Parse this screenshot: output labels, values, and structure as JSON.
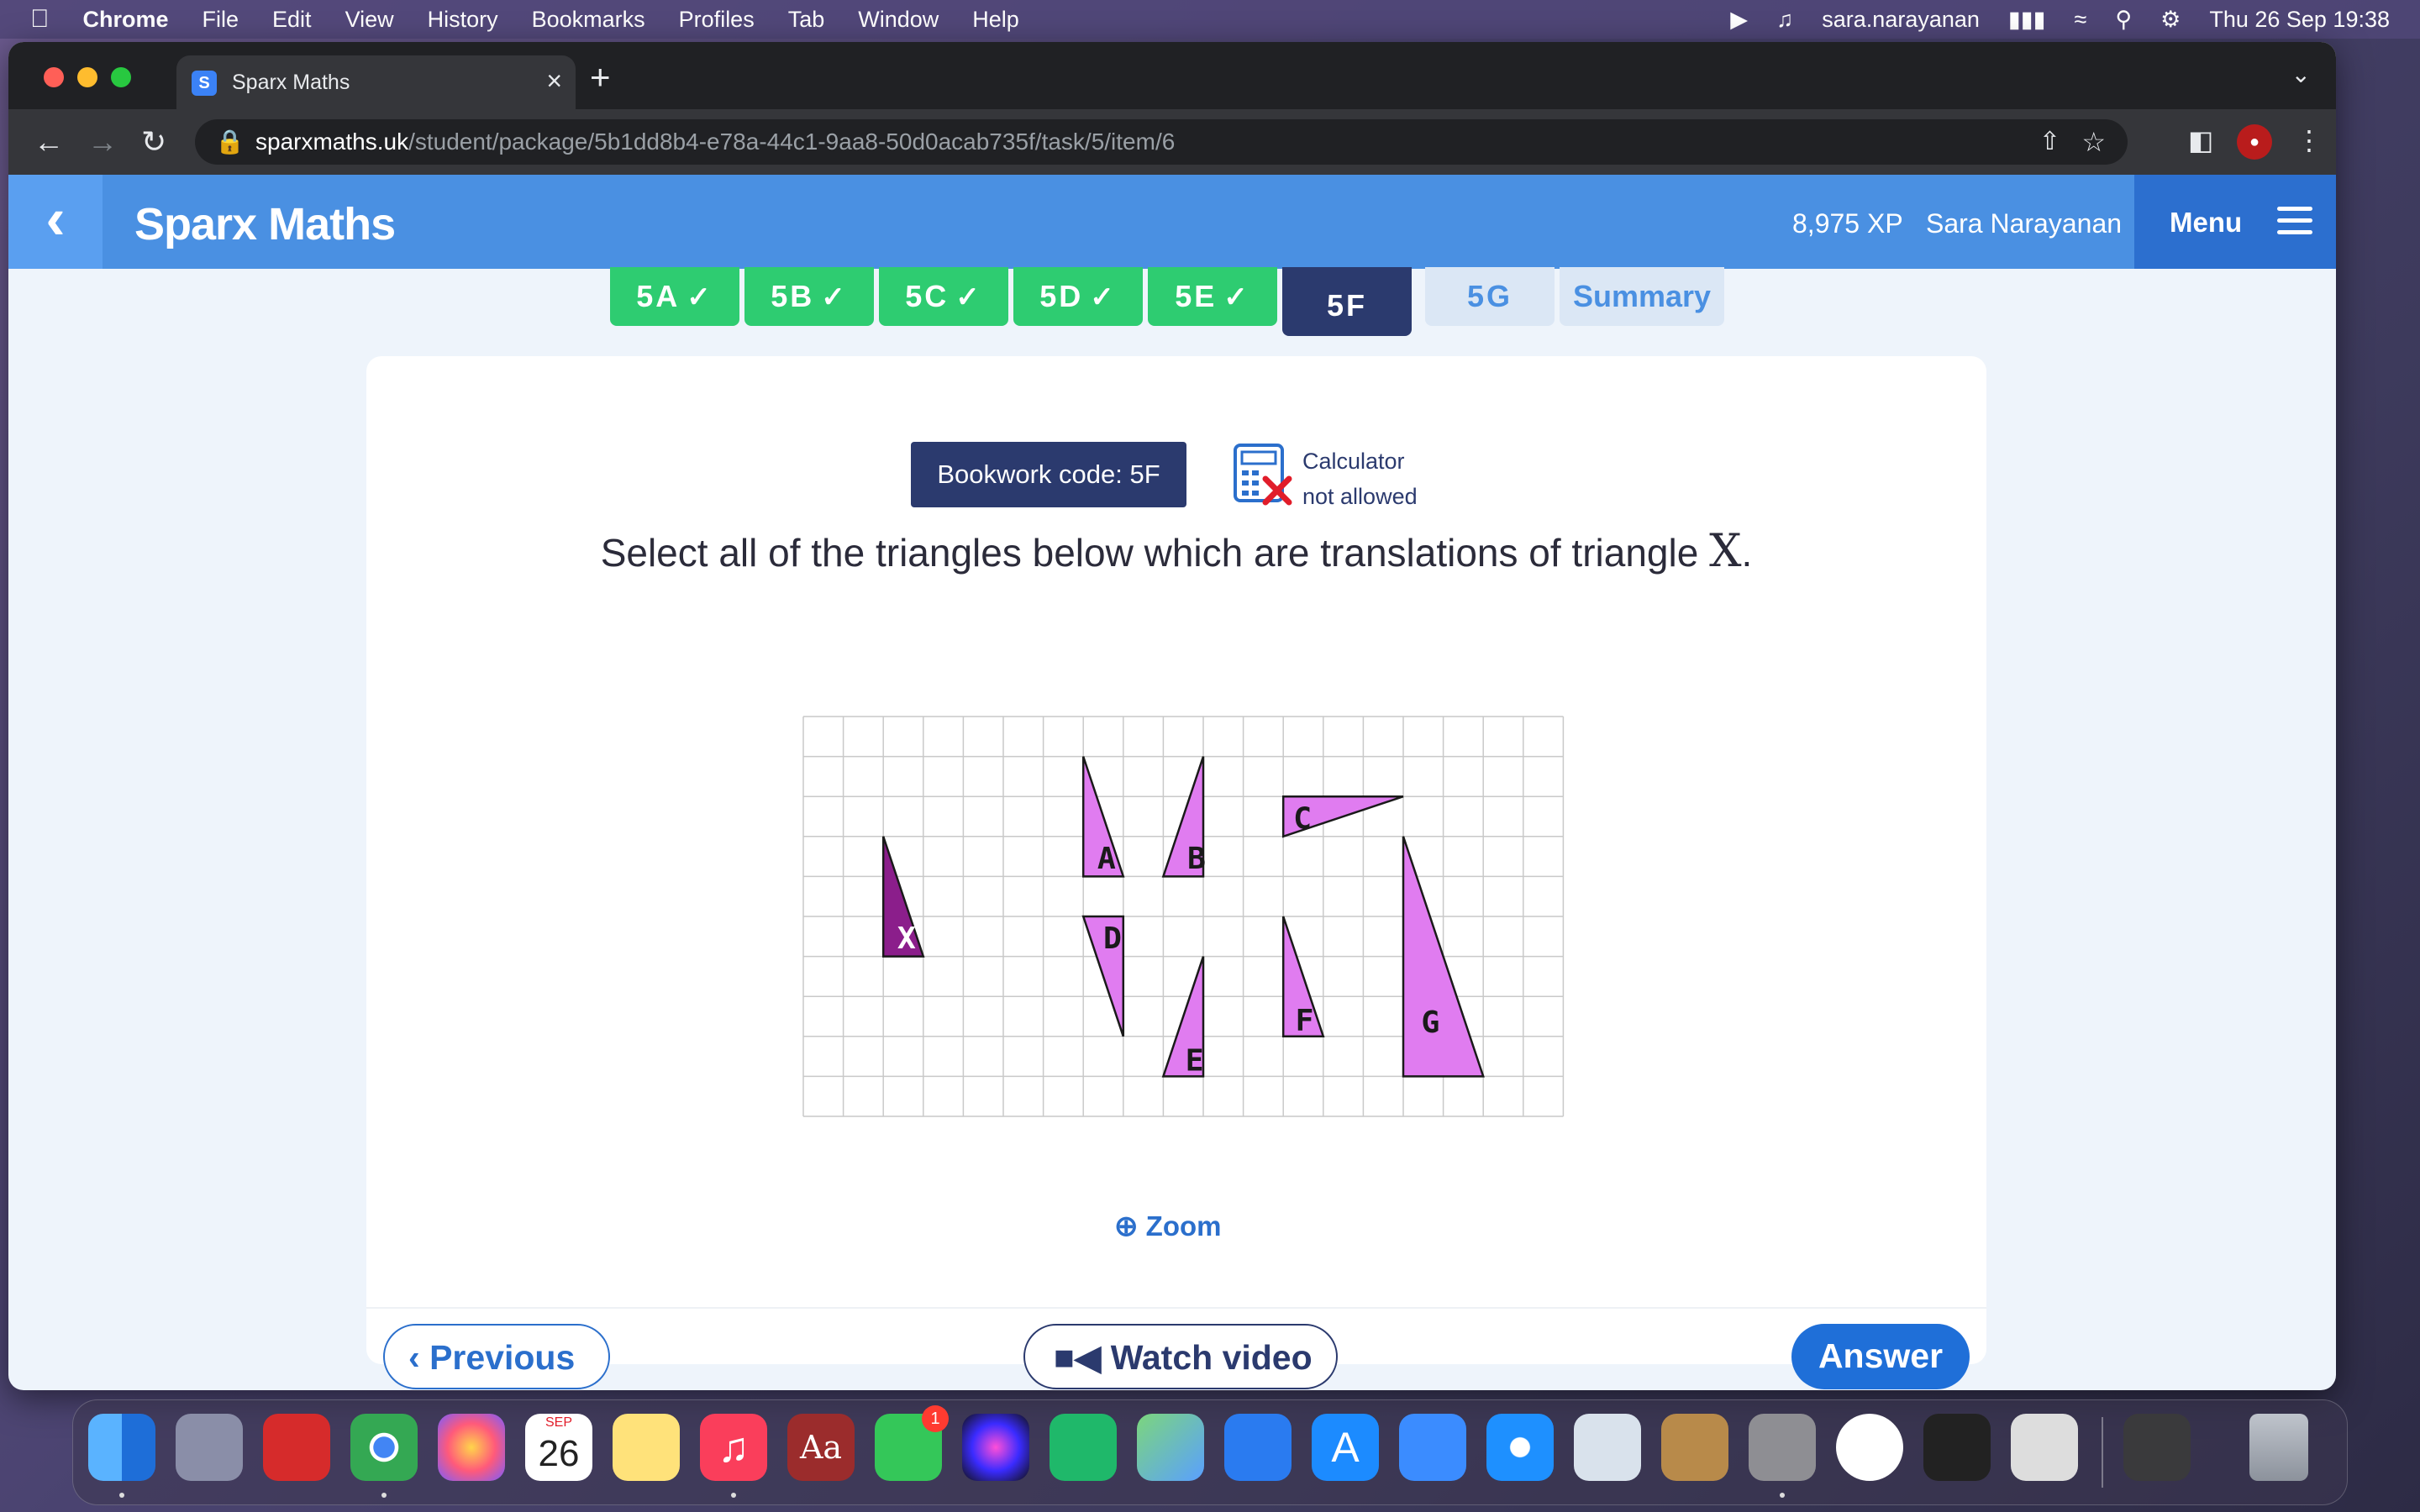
{
  "menubar": {
    "app": "Chrome",
    "items": [
      "File",
      "Edit",
      "View",
      "History",
      "Bookmarks",
      "Profiles",
      "Tab",
      "Window",
      "Help"
    ],
    "user": "sara.narayanan",
    "datetime": "Thu 26 Sep  19:38"
  },
  "browser": {
    "tab_title": "Sparx Maths",
    "tab_favicon": "S",
    "url_host": "sparxmaths.uk",
    "url_path": "/student/package/5b1dd8b4-e78a-44c1-9aa8-50d0acab735f/task/5/item/6"
  },
  "header": {
    "brand": "Sparx Maths",
    "xp": "8,975 XP",
    "user_name": "Sara Narayanan",
    "menu_label": "Menu"
  },
  "task_tabs": [
    {
      "label": "5A",
      "status": "done"
    },
    {
      "label": "5B",
      "status": "done"
    },
    {
      "label": "5C",
      "status": "done"
    },
    {
      "label": "5D",
      "status": "done"
    },
    {
      "label": "5E",
      "status": "done"
    },
    {
      "label": "5F",
      "status": "active"
    },
    {
      "label": "5G",
      "status": "todo"
    },
    {
      "label": "Summary",
      "status": "todo"
    }
  ],
  "question": {
    "bookwork_code": "Bookwork code: 5F",
    "calculator_line1": "Calculator",
    "calculator_line2": "not allowed",
    "text": "Select all of the triangles below which are translations of triangle ",
    "variable": "X",
    "end": ".",
    "triangle_labels": [
      "X",
      "A",
      "B",
      "C",
      "D",
      "E",
      "F",
      "G"
    ]
  },
  "actions": {
    "zoom": "Zoom",
    "previous": "Previous",
    "watch_video": "Watch video",
    "answer": "Answer"
  },
  "dock": {
    "calendar_month": "SEP",
    "calendar_day": "26",
    "messages_badge": "1"
  },
  "colors": {
    "sparx_blue": "#4a90e2",
    "task_done": "#2ecc71",
    "task_active": "#2b3a6e",
    "triangle_fill": "#e07cf0",
    "triangle_x_fill": "#8b1e8b",
    "answer_button": "#1f6fd8"
  }
}
